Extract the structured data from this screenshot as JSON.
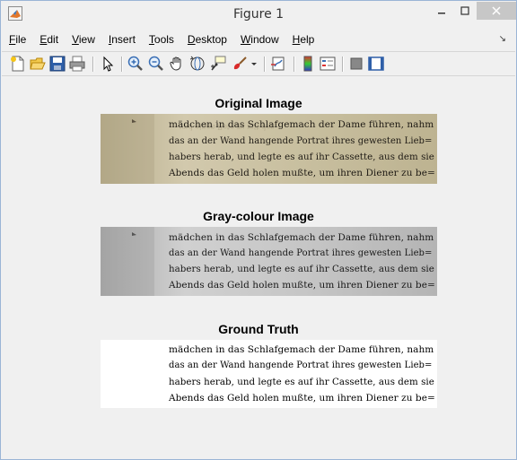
{
  "window": {
    "title": "Figure 1"
  },
  "menu": [
    "File",
    "Edit",
    "View",
    "Insert",
    "Tools",
    "Desktop",
    "Window",
    "Help"
  ],
  "menu_underline": [
    "F",
    "E",
    "V",
    "I",
    "T",
    "D",
    "W",
    "H"
  ],
  "toolbar_icons": [
    "new-figure-icon",
    "open-file-icon",
    "save-icon",
    "print-icon",
    "pointer-icon",
    "zoom-in-icon",
    "zoom-out-icon",
    "pan-icon",
    "rotate-3d-icon",
    "data-cursor-icon",
    "brush-icon",
    "brush-dropdown-icon",
    "link-plot-icon",
    "colorbar-icon",
    "legend-icon",
    "hide-plot-tools-icon",
    "show-plot-tools-icon"
  ],
  "panels": [
    {
      "title": "Original Image",
      "lines": [
        "mädchen in das Schlafgemach der Dame führen, nahm",
        "das an der Wand hangende Portrat ihres gewesten Lieb=",
        "habers herab, und legte es auf ihr Cassette, aus dem sie",
        "Abends das Geld holen mußte, um ihren Diener zu be="
      ]
    },
    {
      "title": "Gray-colour Image",
      "lines": [
        "mädchen in das Schlafgemach der Dame führen, nahm",
        "das an der Wand hangende Portrat ihres gewesten Lieb=",
        "habers herab, und legte es auf ihr Cassette, aus dem sie",
        "Abends das Geld holen mußte, um ihren Diener zu be="
      ]
    },
    {
      "title": "Ground Truth",
      "lines": [
        "mädchen in das Schlafgemach der Dame führen, nahm",
        "das an der Wand hangende Portrat ihres gewesten Lieb=",
        "habers herab, und legte es auf ihr Cassette, aus dem sie",
        "Abends das Geld holen mußte, um ihren Diener zu be="
      ]
    }
  ]
}
